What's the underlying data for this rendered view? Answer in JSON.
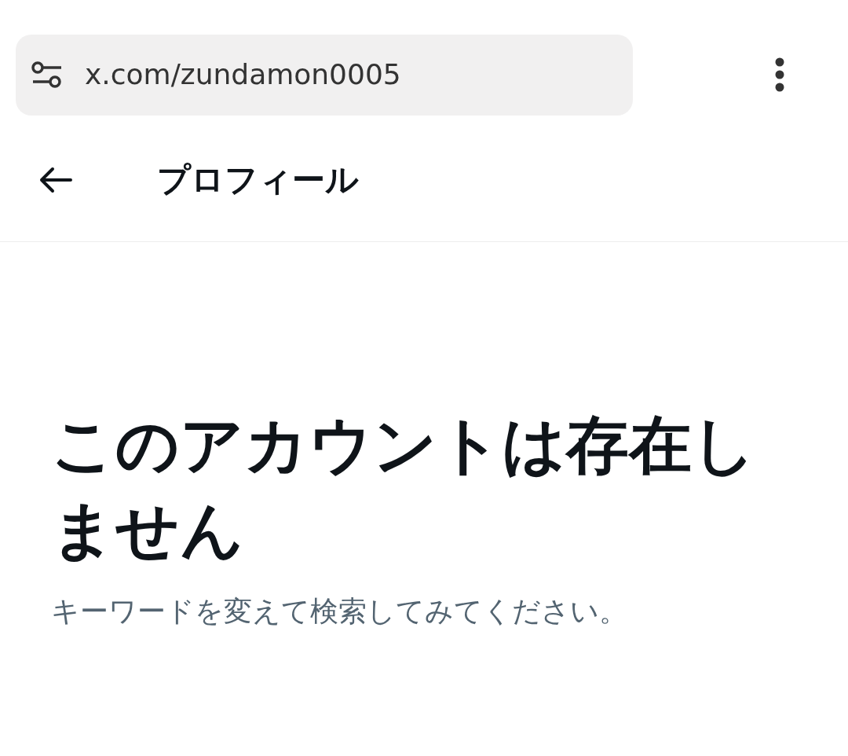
{
  "browser": {
    "url": "x.com/zundamon0005"
  },
  "header": {
    "title": "プロフィール"
  },
  "message": {
    "heading": "このアカウントは存在しません",
    "body": "キーワードを変えて検索してみてください。"
  }
}
